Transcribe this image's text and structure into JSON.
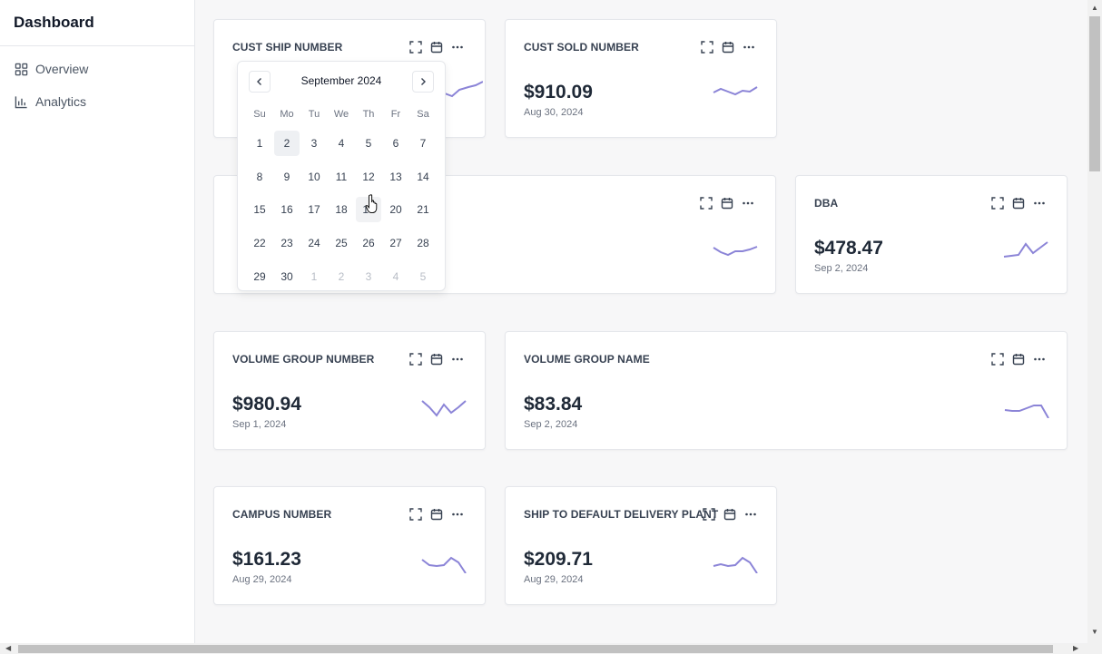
{
  "sidebar": {
    "title": "Dashboard",
    "items": [
      {
        "label": "Overview",
        "icon": "grid-icon"
      },
      {
        "label": "Analytics",
        "icon": "bar-chart-icon"
      }
    ]
  },
  "cards": [
    {
      "title": "CUST SHIP NUMBER",
      "value": "",
      "date": ""
    },
    {
      "title": "CUST SOLD NUMBER",
      "value": "$910.09",
      "date": "Aug 30, 2024"
    },
    {
      "title": "",
      "value": "",
      "date": ""
    },
    {
      "title": "DBA",
      "value": "$478.47",
      "date": "Sep 2, 2024"
    },
    {
      "title": "VOLUME GROUP NUMBER",
      "value": "$980.94",
      "date": "Sep 1, 2024"
    },
    {
      "title": "VOLUME GROUP NAME",
      "value": "$83.84",
      "date": "Sep 2, 2024"
    },
    {
      "title": "CAMPUS NUMBER",
      "value": "$161.23",
      "date": "Aug 29, 2024"
    },
    {
      "title": "SHIP TO DEFAULT DELIVERY PLANT",
      "value": "$209.71",
      "date": "Aug 29, 2024"
    }
  ],
  "calendar": {
    "month_label": "September 2024",
    "weekdays": [
      "Su",
      "Mo",
      "Tu",
      "We",
      "Th",
      "Fr",
      "Sa"
    ],
    "days": [
      "1",
      "2",
      "3",
      "4",
      "5",
      "6",
      "7",
      "8",
      "9",
      "10",
      "11",
      "12",
      "13",
      "14",
      "15",
      "16",
      "17",
      "18",
      "19",
      "20",
      "21",
      "22",
      "23",
      "24",
      "25",
      "26",
      "27",
      "28",
      "29",
      "30",
      "1",
      "2",
      "3",
      "4",
      "5"
    ],
    "today_index": 1,
    "hover_index": 18,
    "outside_from_index": 30
  },
  "colors": {
    "sparkline": "#8b84d7",
    "accent": "#111827"
  }
}
